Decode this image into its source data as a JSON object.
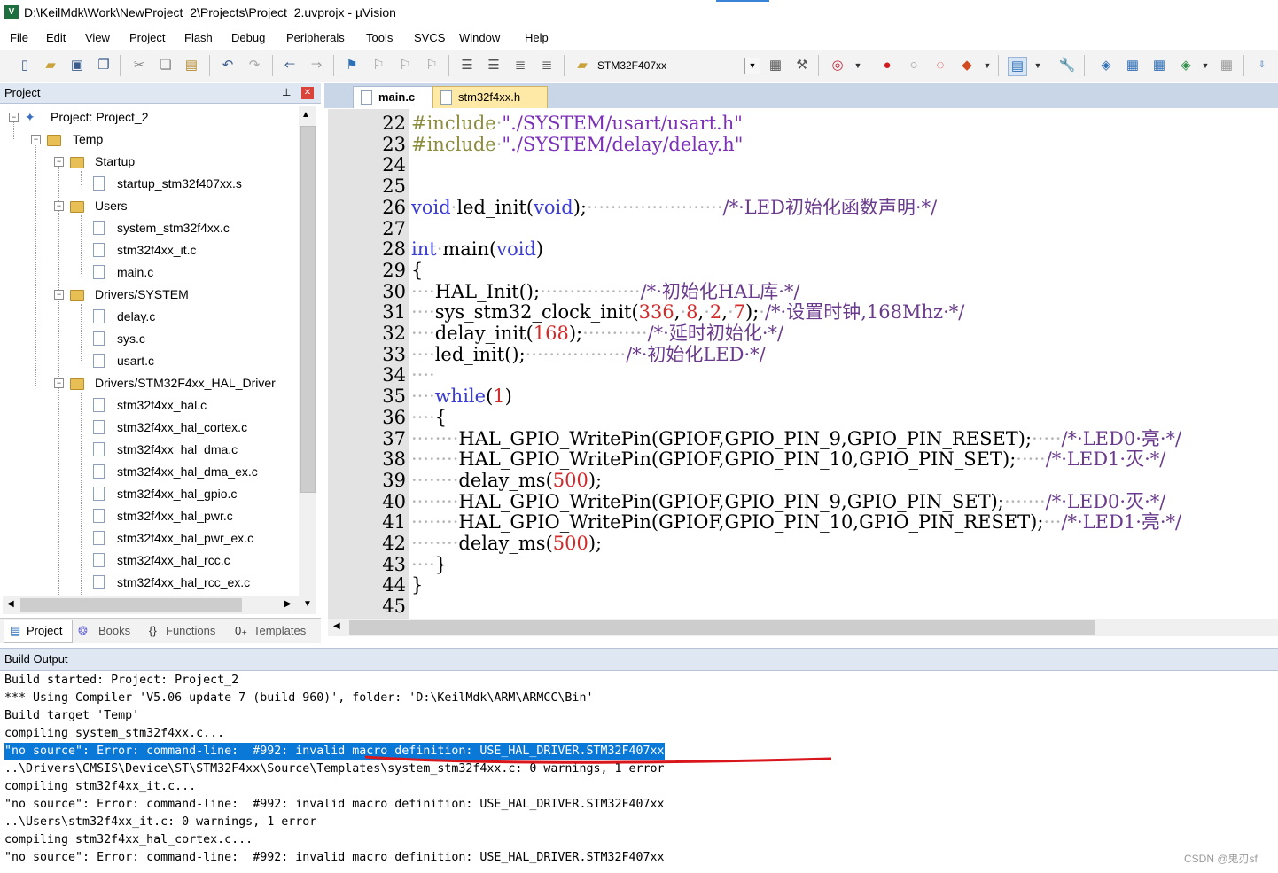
{
  "window": {
    "title": "D:\\KeilMdk\\Work\\NewProject_2\\Projects\\Project_2.uvprojx - µVision",
    "app_icon": "V"
  },
  "menu": [
    "File",
    "Edit",
    "View",
    "Project",
    "Flash",
    "Debug",
    "Peripherals",
    "Tools",
    "SVCS",
    "Window",
    "Help"
  ],
  "toolbar": {
    "target": "STM32F407xx"
  },
  "project_panel": {
    "title": "Project",
    "tree": [
      {
        "label": "Project: Project_2",
        "type": "project",
        "level": 0
      },
      {
        "label": "Temp",
        "type": "target",
        "level": 1
      },
      {
        "label": "Startup",
        "type": "folder",
        "level": 2
      },
      {
        "label": "startup_stm32f407xx.s",
        "type": "file",
        "level": 3
      },
      {
        "label": "Users",
        "type": "folder",
        "level": 2
      },
      {
        "label": "system_stm32f4xx.c",
        "type": "file",
        "level": 3
      },
      {
        "label": "stm32f4xx_it.c",
        "type": "file",
        "level": 3
      },
      {
        "label": "main.c",
        "type": "file",
        "level": 3
      },
      {
        "label": "Drivers/SYSTEM",
        "type": "folder",
        "level": 2
      },
      {
        "label": "delay.c",
        "type": "file",
        "level": 3
      },
      {
        "label": "sys.c",
        "type": "file",
        "level": 3
      },
      {
        "label": "usart.c",
        "type": "file",
        "level": 3
      },
      {
        "label": "Drivers/STM32F4xx_HAL_Driver",
        "type": "folder",
        "level": 2
      },
      {
        "label": "stm32f4xx_hal.c",
        "type": "file",
        "level": 3
      },
      {
        "label": "stm32f4xx_hal_cortex.c",
        "type": "file",
        "level": 3
      },
      {
        "label": "stm32f4xx_hal_dma.c",
        "type": "file",
        "level": 3
      },
      {
        "label": "stm32f4xx_hal_dma_ex.c",
        "type": "file",
        "level": 3
      },
      {
        "label": "stm32f4xx_hal_gpio.c",
        "type": "file",
        "level": 3
      },
      {
        "label": "stm32f4xx_hal_pwr.c",
        "type": "file",
        "level": 3
      },
      {
        "label": "stm32f4xx_hal_pwr_ex.c",
        "type": "file",
        "level": 3
      },
      {
        "label": "stm32f4xx_hal_rcc.c",
        "type": "file",
        "level": 3
      },
      {
        "label": "stm32f4xx_hal_rcc_ex.c",
        "type": "file",
        "level": 3
      }
    ],
    "tabs": [
      "Project",
      "Books",
      "Functions",
      "Templates"
    ]
  },
  "editor": {
    "tabs": [
      "main.c",
      "stm32f4xx.h"
    ],
    "lines": [
      {
        "n": "22",
        "segs": [
          [
            "pp",
            "#include"
          ],
          [
            "dots",
            "·"
          ],
          [
            "str",
            "\"./SYSTEM/usart/usart.h\""
          ]
        ]
      },
      {
        "n": "23",
        "segs": [
          [
            "pp",
            "#include"
          ],
          [
            "dots",
            "·"
          ],
          [
            "str",
            "\"./SYSTEM/delay/delay.h\""
          ]
        ]
      },
      {
        "n": "24",
        "segs": []
      },
      {
        "n": "25",
        "segs": []
      },
      {
        "n": "26",
        "segs": [
          [
            "kw",
            "void"
          ],
          [
            "dots",
            "·"
          ],
          [
            "t",
            "led_init("
          ],
          [
            "kw",
            "void"
          ],
          [
            "t",
            ");"
          ],
          [
            "dots",
            "·······················"
          ],
          [
            "cm",
            "/*·LED初始化函数声明·*/"
          ]
        ]
      },
      {
        "n": "27",
        "segs": []
      },
      {
        "n": "28",
        "segs": [
          [
            "kw",
            "int"
          ],
          [
            "dots",
            "·"
          ],
          [
            "t",
            "main("
          ],
          [
            "kw",
            "void"
          ],
          [
            "t",
            ")"
          ]
        ]
      },
      {
        "n": "29",
        "segs": [
          [
            "t",
            "{"
          ]
        ]
      },
      {
        "n": "30",
        "segs": [
          [
            "dots",
            "····"
          ],
          [
            "t",
            "HAL_Init();"
          ],
          [
            "dots",
            "·················"
          ],
          [
            "cm",
            "/*·初始化HAL库·*/"
          ]
        ]
      },
      {
        "n": "31",
        "segs": [
          [
            "dots",
            "····"
          ],
          [
            "t",
            "sys_stm32_clock_init("
          ],
          [
            "num",
            "336"
          ],
          [
            "t",
            ","
          ],
          [
            "dots",
            "·"
          ],
          [
            "num",
            "8"
          ],
          [
            "t",
            ","
          ],
          [
            "dots",
            "·"
          ],
          [
            "num",
            "2"
          ],
          [
            "t",
            ","
          ],
          [
            "dots",
            "·"
          ],
          [
            "num",
            "7"
          ],
          [
            "t",
            ");"
          ],
          [
            "dots",
            "·"
          ],
          [
            "cm",
            "/*·设置时钟,168Mhz·*/"
          ]
        ]
      },
      {
        "n": "32",
        "segs": [
          [
            "dots",
            "····"
          ],
          [
            "t",
            "delay_init("
          ],
          [
            "num",
            "168"
          ],
          [
            "t",
            ");"
          ],
          [
            "dots",
            "···········"
          ],
          [
            "cm",
            "/*·延时初始化·*/"
          ]
        ]
      },
      {
        "n": "33",
        "segs": [
          [
            "dots",
            "····"
          ],
          [
            "t",
            "led_init();"
          ],
          [
            "dots",
            "·················"
          ],
          [
            "cm",
            "/*·初始化LED·*/"
          ]
        ]
      },
      {
        "n": "34",
        "segs": [
          [
            "dots",
            "····"
          ]
        ]
      },
      {
        "n": "35",
        "segs": [
          [
            "dots",
            "····"
          ],
          [
            "kw",
            "while"
          ],
          [
            "t",
            "("
          ],
          [
            "num",
            "1"
          ],
          [
            "t",
            ")"
          ]
        ]
      },
      {
        "n": "36",
        "segs": [
          [
            "dots",
            "····"
          ],
          [
            "t",
            "{"
          ]
        ]
      },
      {
        "n": "37",
        "segs": [
          [
            "dots",
            "········"
          ],
          [
            "t",
            "HAL_GPIO_WritePin(GPIOF,GPIO_PIN_9,GPIO_PIN_RESET);"
          ],
          [
            "dots",
            "·····"
          ],
          [
            "cm",
            "/*·LED0·亮·*/"
          ]
        ]
      },
      {
        "n": "38",
        "segs": [
          [
            "dots",
            "········"
          ],
          [
            "t",
            "HAL_GPIO_WritePin(GPIOF,GPIO_PIN_10,GPIO_PIN_SET);"
          ],
          [
            "dots",
            "·····"
          ],
          [
            "cm",
            "/*·LED1·灭·*/"
          ]
        ]
      },
      {
        "n": "39",
        "segs": [
          [
            "dots",
            "········"
          ],
          [
            "t",
            "delay_ms("
          ],
          [
            "num",
            "500"
          ],
          [
            "t",
            ");"
          ]
        ]
      },
      {
        "n": "40",
        "segs": [
          [
            "dots",
            "········"
          ],
          [
            "t",
            "HAL_GPIO_WritePin(GPIOF,GPIO_PIN_9,GPIO_PIN_SET);"
          ],
          [
            "dots",
            "·······"
          ],
          [
            "cm",
            "/*·LED0·灭·*/"
          ]
        ]
      },
      {
        "n": "41",
        "segs": [
          [
            "dots",
            "········"
          ],
          [
            "t",
            "HAL_GPIO_WritePin(GPIOF,GPIO_PIN_10,GPIO_PIN_RESET);"
          ],
          [
            "dots",
            "···"
          ],
          [
            "cm",
            "/*·LED1·亮·*/"
          ]
        ]
      },
      {
        "n": "42",
        "segs": [
          [
            "dots",
            "········"
          ],
          [
            "t",
            "delay_ms("
          ],
          [
            "num",
            "500"
          ],
          [
            "t",
            ");"
          ]
        ]
      },
      {
        "n": "43",
        "segs": [
          [
            "dots",
            "····"
          ],
          [
            "t",
            "}"
          ]
        ]
      },
      {
        "n": "44",
        "segs": [
          [
            "t",
            "}"
          ]
        ]
      },
      {
        "n": "45",
        "segs": []
      }
    ]
  },
  "build_output": {
    "title": "Build Output",
    "lines": [
      "Build started: Project: Project_2",
      "*** Using Compiler 'V5.06 update 7 (build 960)', folder: 'D:\\KeilMdk\\ARM\\ARMCC\\Bin'",
      "Build target 'Temp'",
      "compiling system_stm32f4xx.c...",
      "\"no source\": Error: command-line:  #992: invalid macro definition: USE_HAL_DRIVER.STM32F407xx",
      "..\\Drivers\\CMSIS\\Device\\ST\\STM32F4xx\\Source\\Templates\\system_stm32f4xx.c: 0 warnings, 1 error",
      "compiling stm32f4xx_it.c...",
      "\"no source\": Error: command-line:  #992: invalid macro definition: USE_HAL_DRIVER.STM32F407xx",
      "..\\Users\\stm32f4xx_it.c: 0 warnings, 1 error",
      "compiling stm32f4xx_hal_cortex.c...",
      "\"no source\": Error: command-line:  #992: invalid macro definition: USE_HAL_DRIVER.STM32F407xx"
    ],
    "highlighted_index": 4
  },
  "watermark": "CSDN @鬼刃sf"
}
